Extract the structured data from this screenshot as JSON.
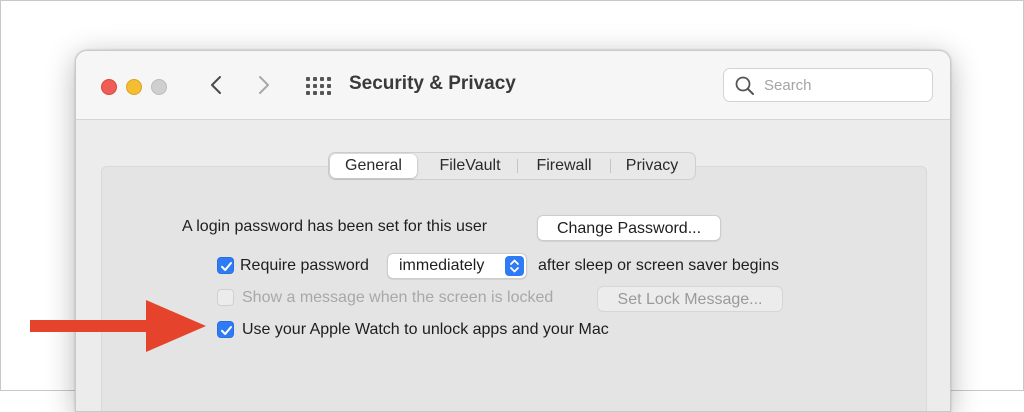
{
  "window": {
    "title": "Security & Privacy",
    "search": {
      "placeholder": "Search"
    }
  },
  "tabs": [
    {
      "label": "General",
      "active": true
    },
    {
      "label": "FileVault",
      "active": false
    },
    {
      "label": "Firewall",
      "active": false
    },
    {
      "label": "Privacy",
      "active": false
    }
  ],
  "general": {
    "login_text": "A login password has been set for this user",
    "change_password_label": "Change Password...",
    "require_password": {
      "checked": true,
      "label": "Require password",
      "select_value": "immediately",
      "suffix": "after sleep or screen saver begins"
    },
    "show_message": {
      "checked": false,
      "enabled": false,
      "label": "Show a message when the screen is locked",
      "button": "Set Lock Message..."
    },
    "apple_watch": {
      "checked": true,
      "label": "Use your Apple Watch to unlock apps and your Mac"
    }
  },
  "colors": {
    "accent": "#2f7bf5",
    "annotation_arrow": "#e5432b"
  },
  "icons": [
    "search-icon",
    "chevron-left-icon",
    "chevron-right-icon",
    "grid-icon",
    "checkmark-icon",
    "stepper-icon",
    "arrow-annotation-icon"
  ]
}
